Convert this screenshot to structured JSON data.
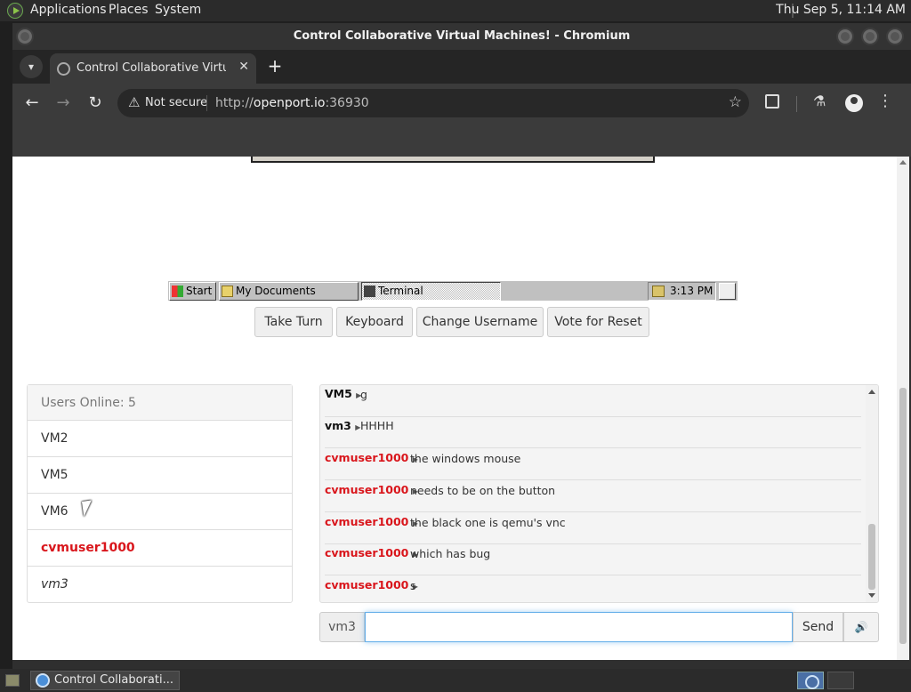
{
  "top_panel": {
    "applications": "Applications",
    "places": "Places",
    "system": "System",
    "clock": "Thu Sep  5, 11:14 AM"
  },
  "window": {
    "title": "Control Collaborative Virtual Machines! - Chromium"
  },
  "tab": {
    "title": "Control Collaborative Virtual Machines!",
    "close": "✕",
    "new_tab": "+"
  },
  "toolbar": {
    "not_secure": "Not secure",
    "url_scheme": "http://",
    "url_host": "openport.io",
    "url_port": ":36930"
  },
  "vm_taskbar": {
    "start": "Start",
    "my_documents": "My Documents",
    "terminal": "Terminal",
    "time": "3:13 PM"
  },
  "controls": {
    "take_turn": "Take Turn",
    "keyboard": "Keyboard",
    "change_username": "Change Username",
    "vote_reset": "Vote for Reset"
  },
  "users": {
    "header": "Users Online: 5",
    "list": [
      "VM2",
      "VM5",
      "VM6",
      "cvmuser1000",
      "vm3"
    ]
  },
  "chat": {
    "messages": [
      {
        "user": "VM5",
        "text": "g"
      },
      {
        "user": "vm3",
        "text": "HHHH"
      },
      {
        "user": "cvmuser1000",
        "text": "the windows mouse"
      },
      {
        "user": "cvmuser1000",
        "text": "needs to be on the button"
      },
      {
        "user": "cvmuser1000",
        "text": "the black one is qemu's vnc"
      },
      {
        "user": "cvmuser1000",
        "text": "which has bug"
      },
      {
        "user": "cvmuser1000",
        "text": "s"
      }
    ],
    "username": "vm3",
    "input_value": "",
    "send": "Send",
    "sound_icon": "🔊"
  },
  "bottom_panel": {
    "task_title": "Control Collaborati..."
  },
  "colors": {
    "username_red": "#d9161c",
    "input_focus": "#66afe9"
  }
}
